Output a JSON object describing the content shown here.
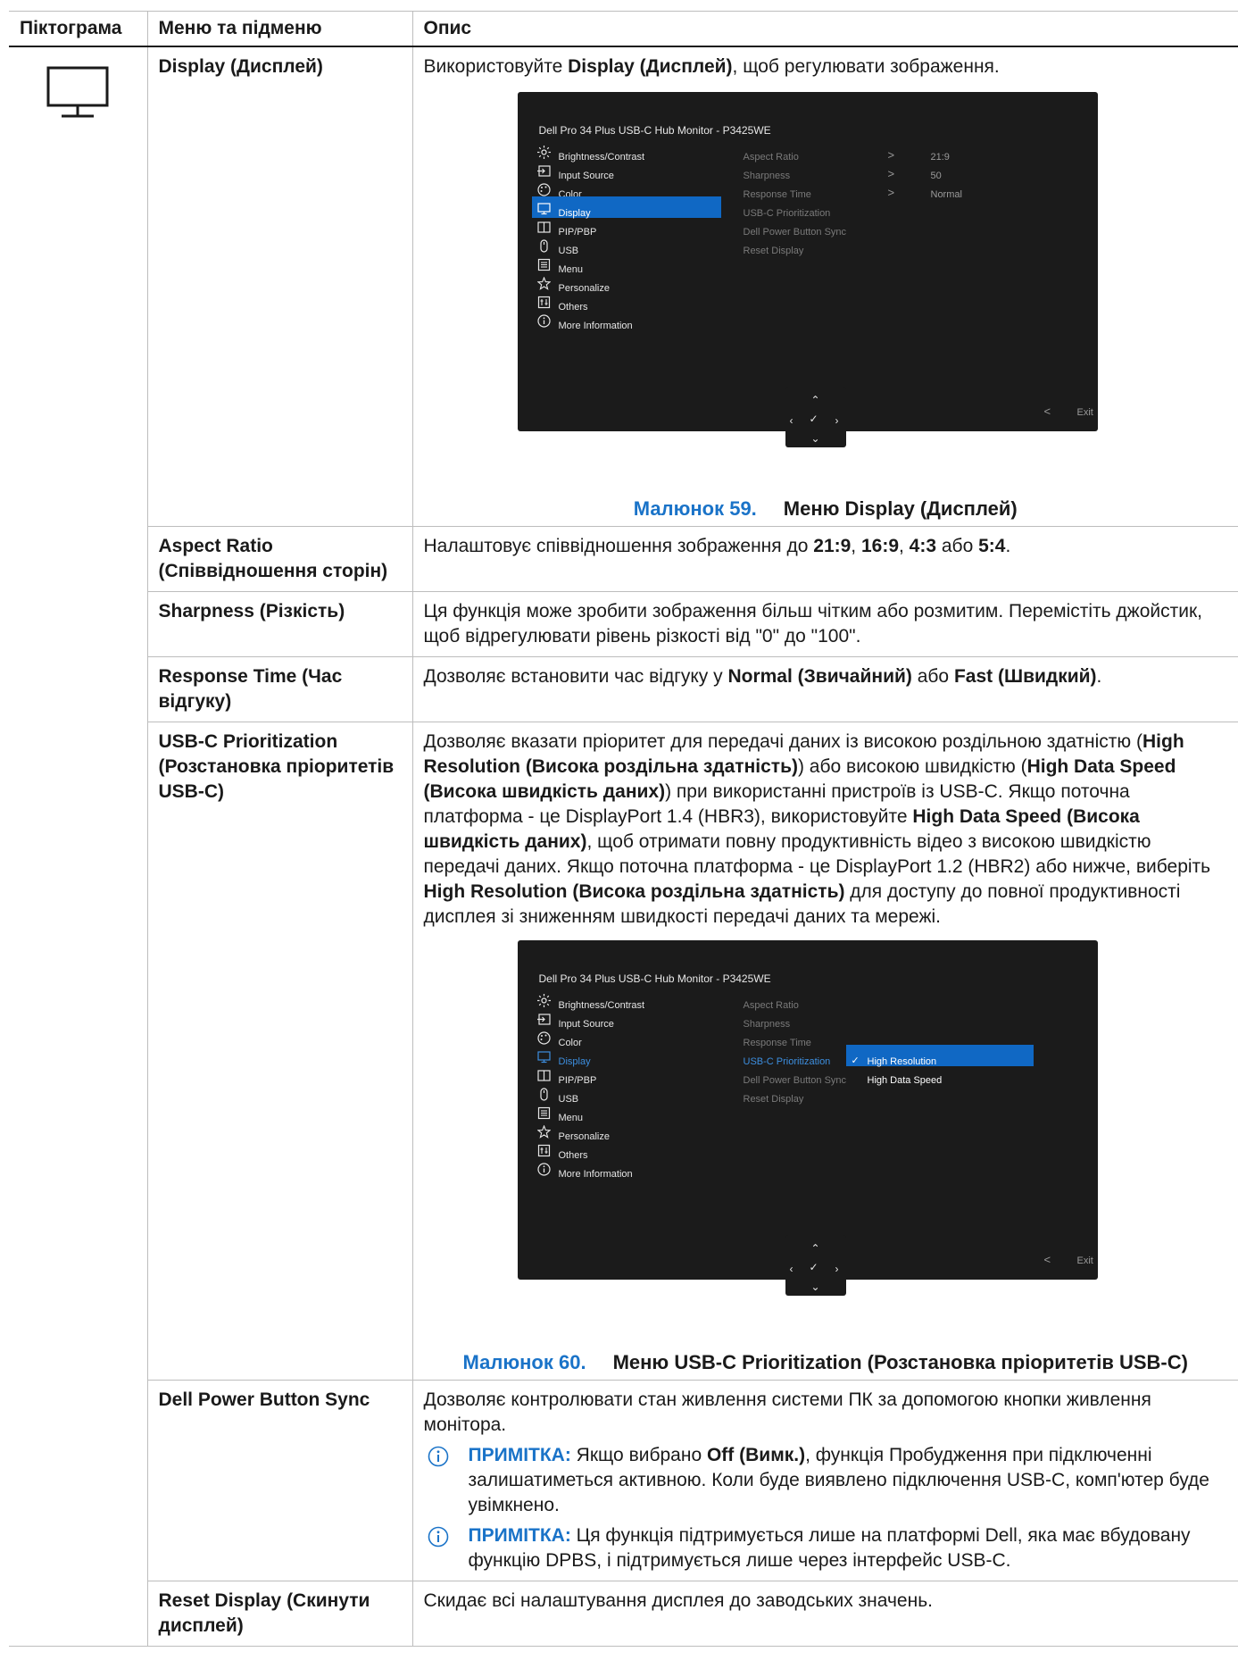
{
  "table": {
    "headers": [
      "Піктограма",
      "Меню та підменю",
      "Опис"
    ]
  },
  "display_row": {
    "name": "Display (Дисплей)",
    "desc_pre": "Використовуйте ",
    "desc_bold": "Display (Дисплей)",
    "desc_post": ", щоб регулювати зображення."
  },
  "osd1": {
    "title": "Dell Pro 34 Plus USB-C Hub Monitor - P3425WE",
    "menu": [
      "Brightness/Contrast",
      "Input Source",
      "Color",
      "Display",
      "PIP/PBP",
      "USB",
      "Menu",
      "Personalize",
      "Others",
      "More Information"
    ],
    "submenu": [
      "Aspect Ratio",
      "Sharpness",
      "Response Time",
      "USB-C Prioritization",
      "Dell Power Button Sync",
      "Reset Display"
    ],
    "values": [
      "21:9",
      "50",
      "Normal"
    ],
    "exit": "Exit"
  },
  "figure59": {
    "num": "Малюнок 59.",
    "text": "Меню Display (Дисплей)"
  },
  "aspect_row": {
    "name": "Aspect Ratio (Співвідношення сторін)",
    "desc_pre": "Налаштовує співвідношення зображення до ",
    "v1": "21:9",
    "sep1": ", ",
    "v2": "16:9",
    "sep2": ", ",
    "v3": "4:3",
    "sep3": " або ",
    "v4": "5:4",
    "end": "."
  },
  "sharp_row": {
    "name": "Sharpness (Різкість)",
    "desc": "Ця функція може зробити зображення більш чітким або розмитим. Перемістіть джойстик, щоб відрегулювати рівень різкості від \"0\" до \"100\"."
  },
  "resp_row": {
    "name": "Response Time (Час відгуку)",
    "desc_pre": "Дозволяє встановити час відгуку у ",
    "b1": "Normal (Звичайний)",
    "mid": " або ",
    "b2": "Fast (Швидкий)",
    "end": "."
  },
  "usbc_row": {
    "name": "USB-C Prioritization (Розстановка пріоритетів USB-C)",
    "p1": "Дозволяє вказати пріоритет для передачі даних із високою роздільною здатністю (",
    "b1": "High Resolution (Висока роздільна здатність)",
    "p2": ") або високою швидкістю (",
    "b2": "High Data Speed (Висока швидкість даних)",
    "p3": ") при використанні пристроїв із USB-C. Якщо поточна платформа - це DisplayPort 1.4 (HBR3), використовуйте ",
    "b3": "High Data Speed (Висока швидкість даних)",
    "p4": ", щоб отримати повну продуктивність відео з високою швидкістю передачі даних. Якщо поточна платформа - це DisplayPort 1.2 (HBR2) або нижче, виберіть ",
    "b4": "High Resolution (Висока роздільна здатність)",
    "p5": " для доступу до повної продуктивності дисплея зі зниженням швидкості передачі даних та мережі."
  },
  "osd2": {
    "title": "Dell Pro 34 Plus USB-C Hub Monitor - P3425WE",
    "options": [
      "High Resolution",
      "High Data Speed"
    ],
    "exit": "Exit"
  },
  "figure60": {
    "num": "Малюнок 60.",
    "text": "Меню USB-C Prioritization (Розстановка пріоритетів USB-C)"
  },
  "dpbs_row": {
    "name": "Dell Power Button Sync",
    "desc": "Дозволяє контролювати стан живлення системи ПК за допомогою кнопки живлення монітора.",
    "note_label": "ПРИМІТКА:",
    "note1_pre": " Якщо вибрано ",
    "note1_bold": "Off (Вимк.)",
    "note1_post": ", функція Пробудження при підключенні залишатиметься активною. Коли буде виявлено підключення USB-C, комп'ютер буде увімкнено.",
    "note2": " Ця функція підтримується лише на платформі Dell, яка має вбудовану функцію DPBS, і підтримується лише через інтерфейс USB-C."
  },
  "reset_row": {
    "name": "Reset Display (Скинути дисплей)",
    "desc": "Скидає всі налаштування дисплея до заводських значень."
  }
}
